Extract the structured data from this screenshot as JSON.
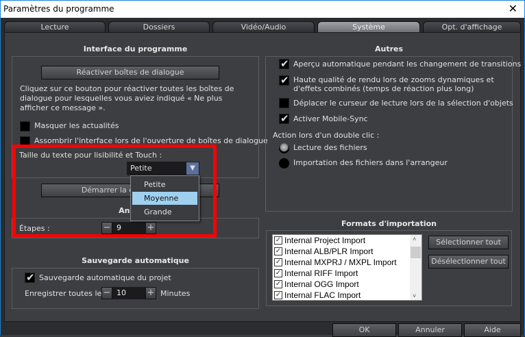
{
  "window": {
    "title": "Paramètres du programme",
    "close_icon": "close-icon"
  },
  "tabs": [
    {
      "label": "Lecture"
    },
    {
      "label": "Dossiers"
    },
    {
      "label": "Vidéo/Audio"
    },
    {
      "label": "Système",
      "active": true
    },
    {
      "label": "Opt. d'affichage"
    }
  ],
  "interface": {
    "header": "Interface du programme",
    "reactivate_button": "Réactiver boîtes de dialogue",
    "description": "Cliquez sur ce bouton pour réactiver toutes les boîtes de dialogue pour lesquelles vous aviez indiqué « Ne plus afficher ce message ».",
    "hide_news": {
      "label": "Masquer les actualités",
      "checked": false
    },
    "darken": {
      "label": "Assombrir l'interface lors de l'ouverture de boîtes de dialogue",
      "checked": false
    },
    "text_size_label": "Taille du texte pour lisibilité et Touch :",
    "text_size_value": "Petite",
    "text_size_options": [
      "Petite",
      "Moyenne",
      "Grande"
    ],
    "highlighted_option": "Moyenne",
    "start_config_button": "Démarrer la configuration"
  },
  "undo": {
    "header": "Annuler",
    "steps_label": "Étapes :",
    "steps_value": "9"
  },
  "autosave": {
    "header": "Sauvegarde automatique",
    "auto_save": {
      "label": "Sauvegarde automatique du projet",
      "checked": true
    },
    "interval_label": "Enregistrer toutes les",
    "interval_value": "10",
    "interval_unit": "Minutes"
  },
  "others": {
    "header": "Autres",
    "options": [
      {
        "label": "Aperçu automatique pendant les changement de transitions",
        "checked": true
      },
      {
        "label": "Haute qualité de rendu lors de zooms dynamiques et d'effets combinés (temps de réaction plus long)",
        "checked": true
      },
      {
        "label": "Déplacer le curseur de lecture lors de la sélection d'objets",
        "checked": false
      },
      {
        "label": "Activer Mobile-Sync",
        "checked": true
      }
    ],
    "double_click_label": "Action lors d'un double clic :",
    "double_click_options": [
      {
        "label": "Lecture des fichiers",
        "selected": true
      },
      {
        "label": "Importation des fichiers dans l'arrangeur",
        "selected": false
      }
    ]
  },
  "import": {
    "header": "Formats d'importation",
    "items": [
      "Internal Project Import",
      "Internal ALB/PLR Import",
      "Internal MXPRJ / MXPL Import",
      "Internal RIFF Import",
      "Internal OGG Import",
      "Internal FLAC Import"
    ],
    "select_all": "Sélectionner tout",
    "deselect_all": "Désélectionner tout"
  },
  "footer": {
    "ok": "OK",
    "cancel": "Annuler",
    "help": "Aide"
  },
  "colors": {
    "highlight": "#ff0000",
    "accent": "#1883d7",
    "selected_option": "#9fd0f0"
  }
}
